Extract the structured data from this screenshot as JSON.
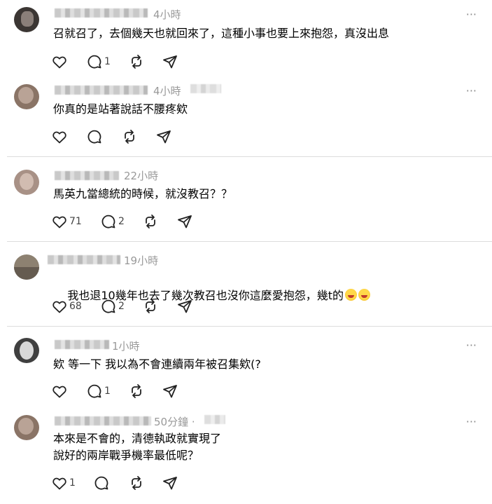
{
  "posts": [
    {
      "time": "4小時",
      "text": "召就召了，去個幾天也就回來了，這種小事也要上來抱怨，真沒出息",
      "likes": "",
      "replies": "1"
    },
    {
      "time": "4小時",
      "text": "你真的是站著說話不腰疼欸",
      "likes": "",
      "replies": ""
    },
    {
      "time": "22小時",
      "text": "馬英九當總統的時候，就沒教召？？",
      "likes": "71",
      "replies": "2"
    },
    {
      "time": "19小時",
      "text": "我也退10幾年也去了幾次教召也沒你這麼愛抱怨，幾t的",
      "emoji_count": 2,
      "emoji_name": "rolling-on-floor-laughing-emoji",
      "likes": "68",
      "replies": "2"
    },
    {
      "time": "1小時",
      "text": "欸 等一下 我以為不會連續兩年被召集欸(?",
      "likes": "",
      "replies": "1"
    },
    {
      "time": "50分鐘 ·",
      "text": "本來是不會的，清德執政就實現了\n說好的兩岸戰爭機率最低呢？",
      "likes": "1",
      "replies": ""
    }
  ],
  "icons": {
    "like": "heart-icon",
    "reply": "comment-icon",
    "repost": "repost-icon",
    "share": "send-icon",
    "more": "more-icon"
  },
  "more_glyph": "···",
  "colors": {
    "text": "#000000",
    "meta": "#999999",
    "icon": "#222222",
    "divider": "#dcdcdc"
  }
}
